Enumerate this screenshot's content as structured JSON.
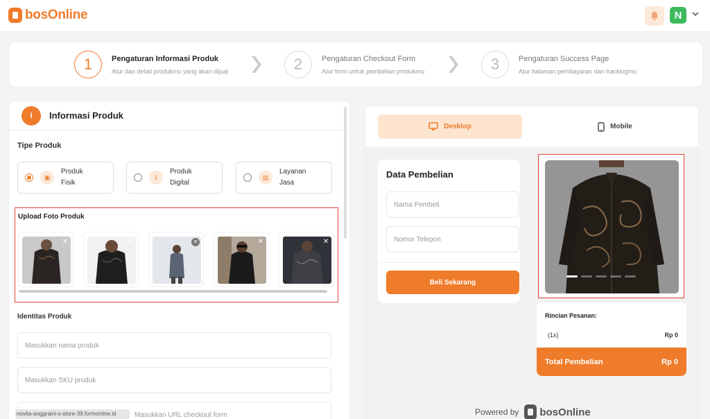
{
  "header": {
    "brand": "bosOnline",
    "avatar_initial": "N"
  },
  "stepper": {
    "steps": [
      {
        "number": "1",
        "title": "Pengaturan Informasi Produk",
        "subtitle": "Atur dan detail produkmu yang akan dijual",
        "active": true
      },
      {
        "number": "2",
        "title": "Pengaturan Checkout Form",
        "subtitle": "Atur form untuk pembelian produkmu",
        "active": false
      },
      {
        "number": "3",
        "title": "Pengaturan Success Page",
        "subtitle": "Atur halaman pembayaran dan trackingmu",
        "active": false
      }
    ]
  },
  "left": {
    "title": "Informasi Produk",
    "tipe_label": "Tipe Produk",
    "types": [
      {
        "line1": "Produk",
        "line2": "Fisik",
        "selected": true
      },
      {
        "line1": "Produk",
        "line2": "Digital",
        "selected": false
      },
      {
        "line1": "Layanan",
        "line2": "Jasa",
        "selected": false
      }
    ],
    "upload_label": "Upload Foto Produk",
    "thumbnails": [
      {
        "remove": "✕",
        "bg": "#ccc"
      },
      {
        "remove": "✕",
        "bg": "#f1f1f1"
      },
      {
        "remove": "✕",
        "bg": "#dfe4ea"
      },
      {
        "remove": "✕",
        "bg": "#bdb5a8"
      },
      {
        "remove": "✕",
        "bg": "#3a3a3a"
      }
    ],
    "identitas_label": "Identitas Produk",
    "fields": {
      "name_placeholder": "Masukkan nama produk",
      "sku_placeholder": "Masukkan SKU produk",
      "url_placeholder": "Masukkan URL checkout form"
    },
    "url_prefix": "novita-anggraini-s-store-39.formonline.id"
  },
  "right": {
    "tabs": [
      {
        "label": "Desktop",
        "icon": "monitor-icon",
        "active": true
      },
      {
        "label": "Mobile",
        "icon": "phone-icon",
        "active": false
      }
    ],
    "form": {
      "title": "Data Pembelian",
      "name_placeholder": "Nama Pembeli",
      "phone_placeholder": "Nomor Telepon",
      "button": "Beli Sekarang"
    },
    "summary": {
      "title": "Rincian Pesanan:",
      "qty": "(1x)",
      "qty_price": "Rp 0",
      "total_label": "Total Pembelian",
      "total_value": "Rp 0"
    },
    "powered_by": "Powered by",
    "powered_brand": "bosOnline"
  },
  "colors": {
    "accent": "#ef7c2b",
    "highlight_border": "#e0432e",
    "avatar_green": "#3dbb5d"
  }
}
